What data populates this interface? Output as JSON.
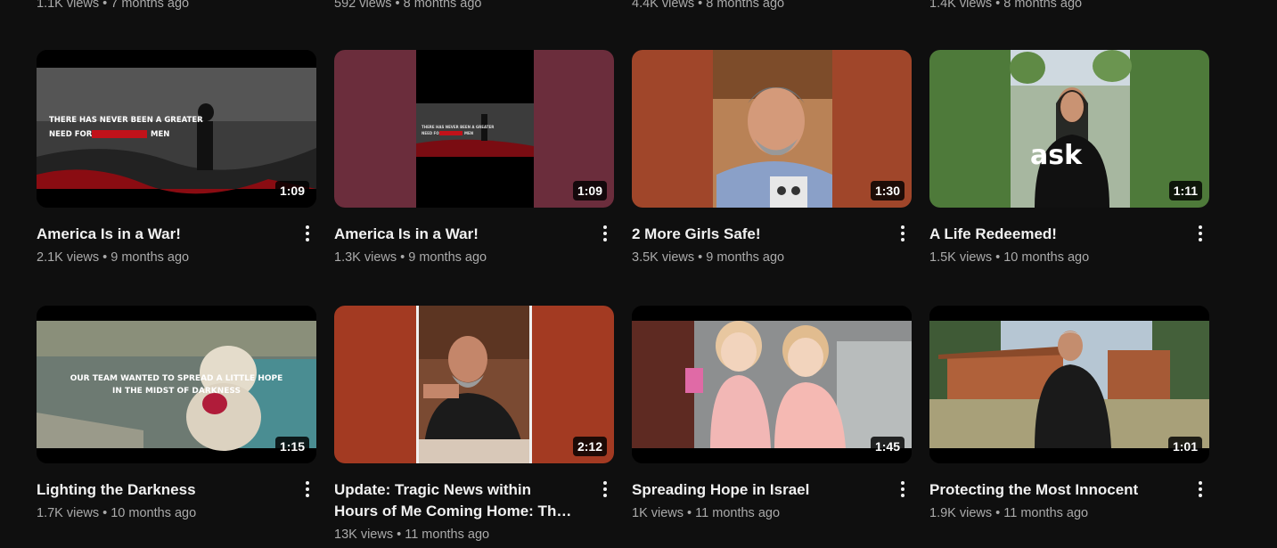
{
  "top_row_meta": [
    "1.1K views • 7 months ago",
    "592 views • 8 months ago",
    "4.4K views • 8 months ago",
    "1.4K views • 8 months ago"
  ],
  "videos": [
    {
      "title": "America Is in a War!",
      "meta": "2.1K views • 9 months ago",
      "duration": "1:09",
      "thumb_text": [
        "THERE HAS NEVER BEEN A GREATER",
        "NEED FOR",
        "MEN"
      ]
    },
    {
      "title": "America Is in a War!",
      "meta": "1.3K views • 9 months ago",
      "duration": "1:09",
      "thumb_text": [
        "THERE HAS NEVER BEEN A GREATER",
        "NEED FOR",
        "MEN"
      ]
    },
    {
      "title": "2 More Girls Safe!",
      "meta": "3.5K views • 9 months ago",
      "duration": "1:30"
    },
    {
      "title": "A Life Redeemed!",
      "meta": "1.5K views • 10 months ago",
      "duration": "1:11",
      "thumb_text": [
        "ask"
      ]
    },
    {
      "title": "Lighting the Darkness",
      "meta": "1.7K views • 10 months ago",
      "duration": "1:15",
      "thumb_text": [
        "OUR TEAM WANTED TO SPREAD A LITTLE HOPE",
        "IN THE MIDST OF DARKNESS"
      ]
    },
    {
      "title": "Update: Tragic News within Hours of Me Coming Home: The Fella Who Helped Us",
      "meta": "13K views • 11 months ago",
      "duration": "2:12"
    },
    {
      "title": "Spreading Hope in Israel",
      "meta": "1K views • 11 months ago",
      "duration": "1:45"
    },
    {
      "title": "Protecting the Most Innocent",
      "meta": "1.9K views • 11 months ago",
      "duration": "1:01"
    }
  ],
  "icons": {
    "more": "more-vert-icon"
  },
  "colors": {
    "background": "#0f0f0f",
    "title": "#f1f1f1",
    "meta": "#aaaaaa",
    "maroon": "#6b2d3c",
    "terracotta": "#a0462a",
    "green": "#4e7a3a"
  }
}
